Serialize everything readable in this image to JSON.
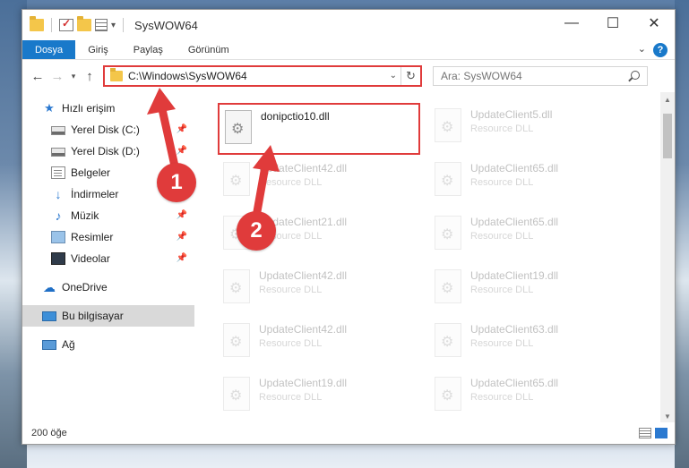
{
  "window": {
    "title": "SysWOW64",
    "controls": {
      "minimize": "—",
      "maximize": "☐",
      "close": "✕"
    }
  },
  "ribbon": {
    "tabs": [
      {
        "label": "Dosya",
        "active": true
      },
      {
        "label": "Giriş",
        "active": false
      },
      {
        "label": "Paylaş",
        "active": false
      },
      {
        "label": "Görünüm",
        "active": false
      }
    ],
    "help": "?"
  },
  "address": {
    "path": "C:\\Windows\\SysWOW64",
    "search_placeholder": "Ara: SysWOW64"
  },
  "nav": {
    "quick_access": "Hızlı erişim",
    "items": [
      {
        "label": "Yerel Disk (C:)",
        "icon": "disk-icon"
      },
      {
        "label": "Yerel Disk (D:)",
        "icon": "disk-icon"
      },
      {
        "label": "Belgeler",
        "icon": "documents-icon"
      },
      {
        "label": "İndirmeler",
        "icon": "download-icon"
      },
      {
        "label": "Müzik",
        "icon": "music-icon"
      },
      {
        "label": "Resimler",
        "icon": "pictures-icon"
      },
      {
        "label": "Videolar",
        "icon": "videos-icon"
      }
    ],
    "onedrive": "OneDrive",
    "this_pc": "Bu bilgisayar",
    "network": "Ağ"
  },
  "files": {
    "highlighted": {
      "name": "donipctio10.dll"
    },
    "left_column": [
      {
        "name": "UpdateClient42.dll",
        "desc": "Resource DLL"
      },
      {
        "name": "UpdateClient21.dll",
        "desc": "Resource DLL"
      },
      {
        "name": "UpdateClient42.dll",
        "desc": "Resource DLL"
      },
      {
        "name": "UpdateClient42.dll",
        "desc": "Resource DLL"
      },
      {
        "name": "UpdateClient19.dll",
        "desc": "Resource DLL"
      }
    ],
    "right_column": [
      {
        "name": "UpdateClient5.dll",
        "desc": "Resource DLL"
      },
      {
        "name": "UpdateClient65.dll",
        "desc": "Resource DLL"
      },
      {
        "name": "UpdateClient65.dll",
        "desc": "Resource DLL"
      },
      {
        "name": "UpdateClient19.dll",
        "desc": "Resource DLL"
      },
      {
        "name": "UpdateClient63.dll",
        "desc": "Resource DLL"
      },
      {
        "name": "UpdateClient65.dll",
        "desc": "Resource DLL"
      }
    ]
  },
  "status": {
    "count": "200 öğe"
  },
  "annotations": {
    "marker1": "1",
    "marker2": "2",
    "color": "#e03b3b"
  },
  "colors": {
    "accent": "#1979ca",
    "highlight": "#e03b3b",
    "selection": "#d9d9d9"
  }
}
